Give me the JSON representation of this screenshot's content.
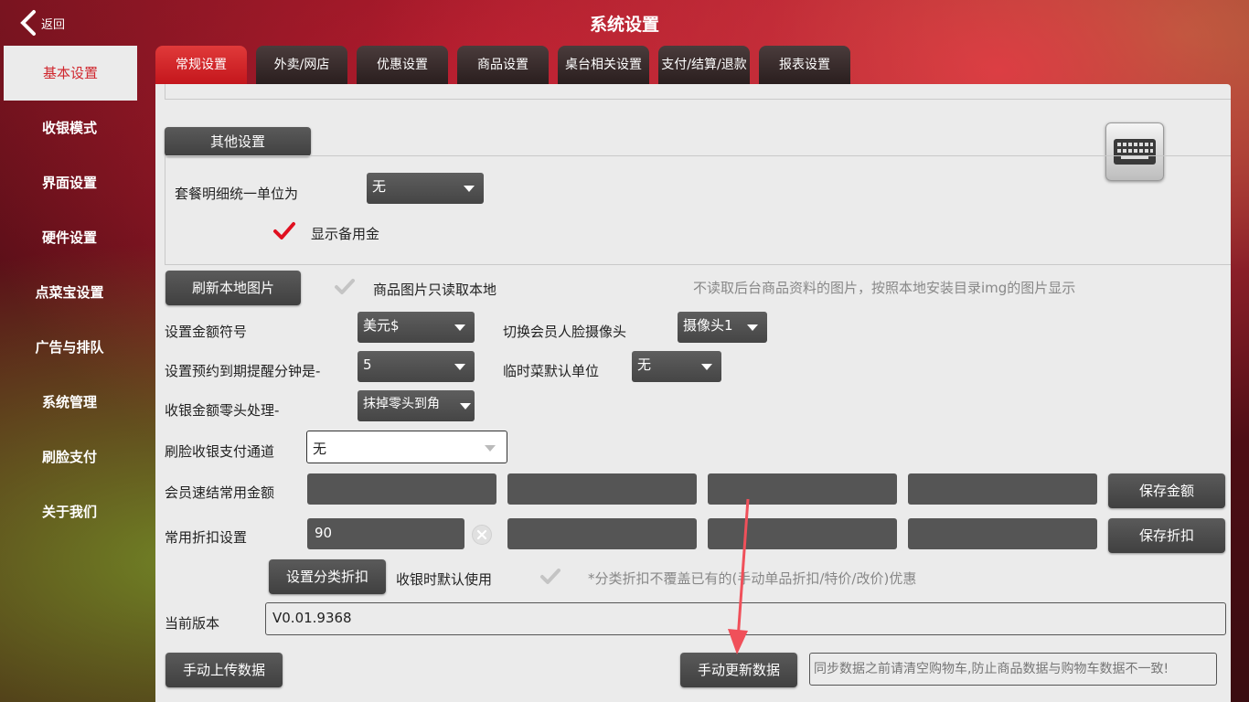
{
  "header": {
    "back_label": "返回",
    "title": "系统设置"
  },
  "sidebar": {
    "items": [
      {
        "label": "基本设置"
      },
      {
        "label": "收银模式"
      },
      {
        "label": "界面设置"
      },
      {
        "label": "硬件设置"
      },
      {
        "label": "点菜宝设置"
      },
      {
        "label": "广告与排队"
      },
      {
        "label": "系统管理"
      },
      {
        "label": "刷脸支付"
      },
      {
        "label": "关于我们"
      }
    ],
    "active_index": 0
  },
  "tabs": [
    {
      "label": "常规设置"
    },
    {
      "label": "外卖/网店"
    },
    {
      "label": "优惠设置"
    },
    {
      "label": "商品设置"
    },
    {
      "label": "桌台相关设置"
    },
    {
      "label": "支付/结算/退款"
    },
    {
      "label": "报表设置"
    }
  ],
  "other": {
    "section_button": "其他设置",
    "combo_unit_label": "套餐明细统一单位为",
    "combo_unit_value": "无",
    "show_reserve_label": "显示备用金",
    "show_reserve_checked": true
  },
  "images": {
    "refresh_button": "刷新本地图片",
    "local_only_label": "商品图片只读取本地",
    "local_only_checked": false,
    "hint": "不读取后台商品资料的图片，按照本地安装目录img的图片显示"
  },
  "currency": {
    "label": "设置金额符号",
    "value": "美元$"
  },
  "camera": {
    "label": "切换会员人脸摄像头",
    "value": "摄像头1"
  },
  "reminder": {
    "label": "设置预约到期提醒分钟是-",
    "value": "5"
  },
  "temp_unit": {
    "label": "临时菜默认单位",
    "value": "无"
  },
  "rounding": {
    "label": "收银金额零头处理-",
    "value": "抹掉零头到角"
  },
  "face_channel": {
    "label": "刷脸收银支付通道",
    "value": "无"
  },
  "member_amount": {
    "label": "会员速结常用金额",
    "values": [
      "",
      "",
      "",
      ""
    ],
    "save_button": "保存金额"
  },
  "discount": {
    "label": "常用折扣设置",
    "values": [
      "90",
      "",
      "",
      ""
    ],
    "save_button": "保存折扣"
  },
  "category_discount": {
    "button": "设置分类折扣",
    "default_label": "收银时默认使用",
    "checked": false,
    "hint": "*分类折扣不覆盖已有的(手动单品折扣/特价/改价)优惠"
  },
  "version": {
    "label": "当前版本",
    "value": "V0.01.9368"
  },
  "sync": {
    "upload_button": "手动上传数据",
    "update_button": "手动更新数据",
    "placeholder": "同步数据之前请清空购物车,防止商品数据与购物车数据不一致!"
  },
  "colors": {
    "accent": "#d0282f",
    "button": "#4a4a4a",
    "annotation_arrow": "#f0505a"
  }
}
